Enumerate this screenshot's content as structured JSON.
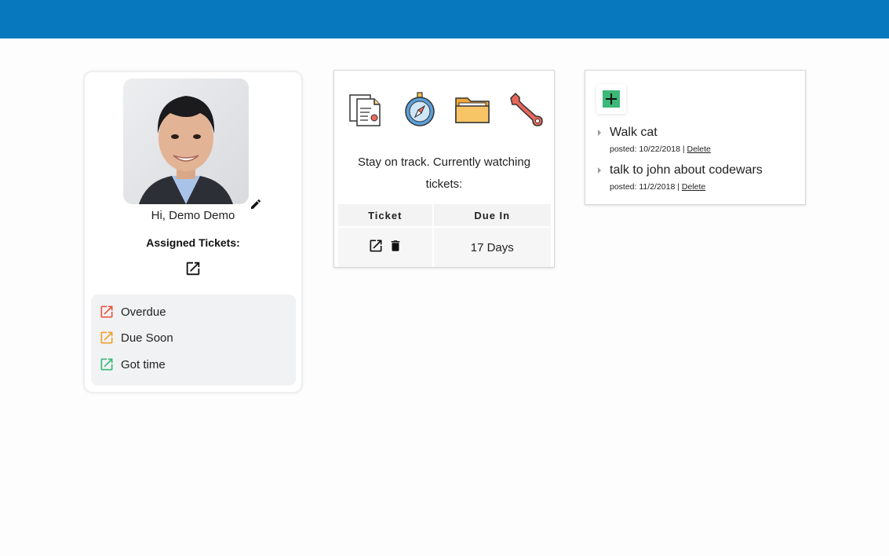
{
  "colors": {
    "header": "#0878be",
    "overdue": "#e8563f",
    "due_soon": "#f0a030",
    "got_time": "#3cb878",
    "add": "#3cb878"
  },
  "profile": {
    "greeting": "Hi, Demo Demo",
    "assigned_label": "Assigned Tickets:",
    "legend": [
      {
        "label": "Overdue",
        "icon": "open-in-new-icon"
      },
      {
        "label": "Due Soon",
        "icon": "open-in-new-icon"
      },
      {
        "label": "Got time",
        "icon": "open-in-new-icon"
      }
    ]
  },
  "watch": {
    "icons": [
      "documents-icon",
      "compass-icon",
      "folder-icon",
      "wrench-icon"
    ],
    "message": "Stay on track. Currently watching tickets:",
    "table": {
      "headers": [
        "Ticket",
        "Due In"
      ],
      "rows": [
        {
          "due_in": "17 Days"
        }
      ]
    }
  },
  "todos": {
    "items": [
      {
        "title": "Walk cat",
        "posted": "posted: 10/22/2018 |",
        "delete_label": "Delete"
      },
      {
        "title": "talk to john about codewars",
        "posted": "posted: 11/2/2018 |",
        "delete_label": "Delete"
      }
    ]
  }
}
